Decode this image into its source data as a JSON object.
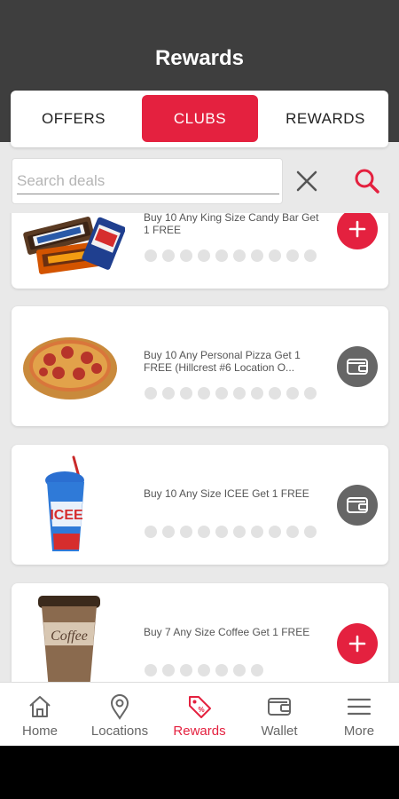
{
  "header": {
    "title": "Rewards"
  },
  "tabs": [
    {
      "label": "OFFERS",
      "active": false
    },
    {
      "label": "CLUBS",
      "active": true
    },
    {
      "label": "REWARDS",
      "active": false
    }
  ],
  "search": {
    "placeholder": "Search deals",
    "value": ""
  },
  "cards": [
    {
      "title": "Buy 10 Any King Size Candy Bar Get 1 FREE",
      "image": "candy-bars-image",
      "punches_total": 10,
      "punches_filled": 0,
      "action": "add-icon"
    },
    {
      "title": "Buy 10 Any Personal Pizza Get 1 FREE (Hillcrest #6 Location O...",
      "image": "pizza-image",
      "punches_total": 10,
      "punches_filled": 0,
      "action": "wallet-icon"
    },
    {
      "title": "Buy 10 Any Size ICEE Get 1 FREE",
      "image": "icee-cup-image",
      "punches_total": 10,
      "punches_filled": 0,
      "action": "wallet-icon"
    },
    {
      "title": "Buy 7 Any Size Coffee Get 1 FREE",
      "image": "coffee-cup-image",
      "punches_total": 7,
      "punches_filled": 0,
      "action": "add-icon"
    }
  ],
  "nav": [
    {
      "label": "Home",
      "icon": "home-icon",
      "active": false
    },
    {
      "label": "Locations",
      "icon": "location-pin-icon",
      "active": false
    },
    {
      "label": "Rewards",
      "icon": "tag-icon",
      "active": true
    },
    {
      "label": "Wallet",
      "icon": "wallet-icon",
      "active": false
    },
    {
      "label": "More",
      "icon": "menu-icon",
      "active": false
    }
  ],
  "colors": {
    "accent": "#e4213f",
    "header": "#3e3e3e",
    "wallet_button": "#666666",
    "punch_dot": "#e2e2e2"
  }
}
